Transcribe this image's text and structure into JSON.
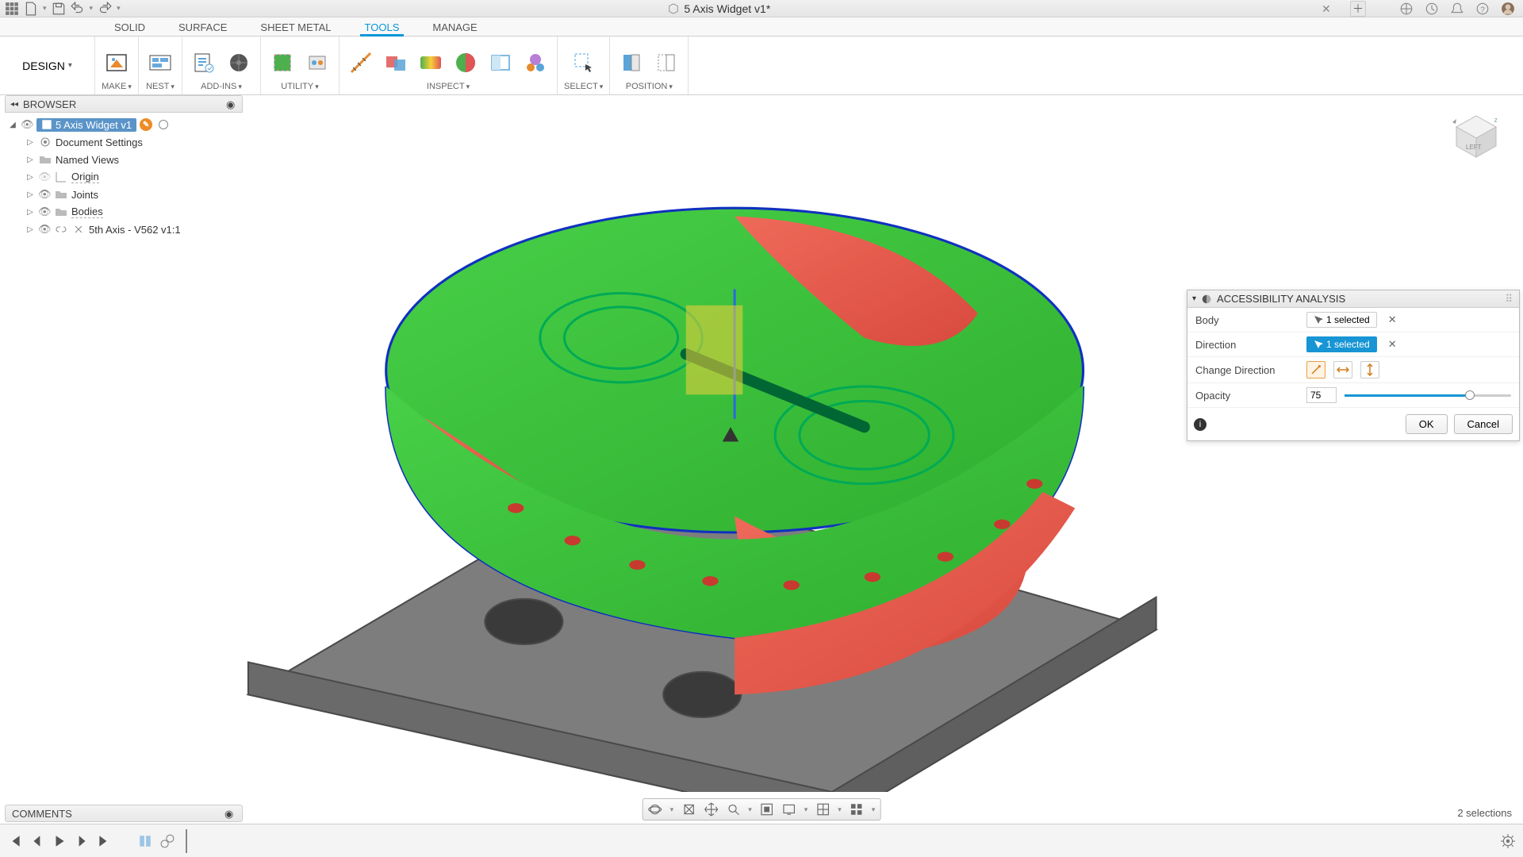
{
  "titlebar": {
    "document_title": "5 Axis Widget v1*"
  },
  "ribbon": {
    "tabs": [
      "SOLID",
      "SURFACE",
      "SHEET METAL",
      "TOOLS",
      "MANAGE"
    ],
    "active_tab": "TOOLS",
    "design_button": "DESIGN",
    "groups": {
      "make": "MAKE",
      "nest": "NEST",
      "addins": "ADD-INS",
      "utility": "UTILITY",
      "inspect": "INSPECT",
      "select": "SELECT",
      "position": "POSITION"
    }
  },
  "browser": {
    "title": "BROWSER",
    "root": "5 Axis Widget v1",
    "items": {
      "doc_settings": "Document Settings",
      "named_views": "Named Views",
      "origin": "Origin",
      "joints": "Joints",
      "bodies": "Bodies",
      "component": "5th Axis - V562 v1:1"
    }
  },
  "acc_panel": {
    "title": "ACCESSIBILITY ANALYSIS",
    "body_label": "Body",
    "body_value": "1 selected",
    "direction_label": "Direction",
    "direction_value": "1 selected",
    "change_dir_label": "Change Direction",
    "opacity_label": "Opacity",
    "opacity_value": "75",
    "ok": "OK",
    "cancel": "Cancel"
  },
  "comments": {
    "title": "COMMENTS"
  },
  "status": {
    "selections": "2 selections"
  },
  "viewcube": {
    "front_label": ""
  }
}
